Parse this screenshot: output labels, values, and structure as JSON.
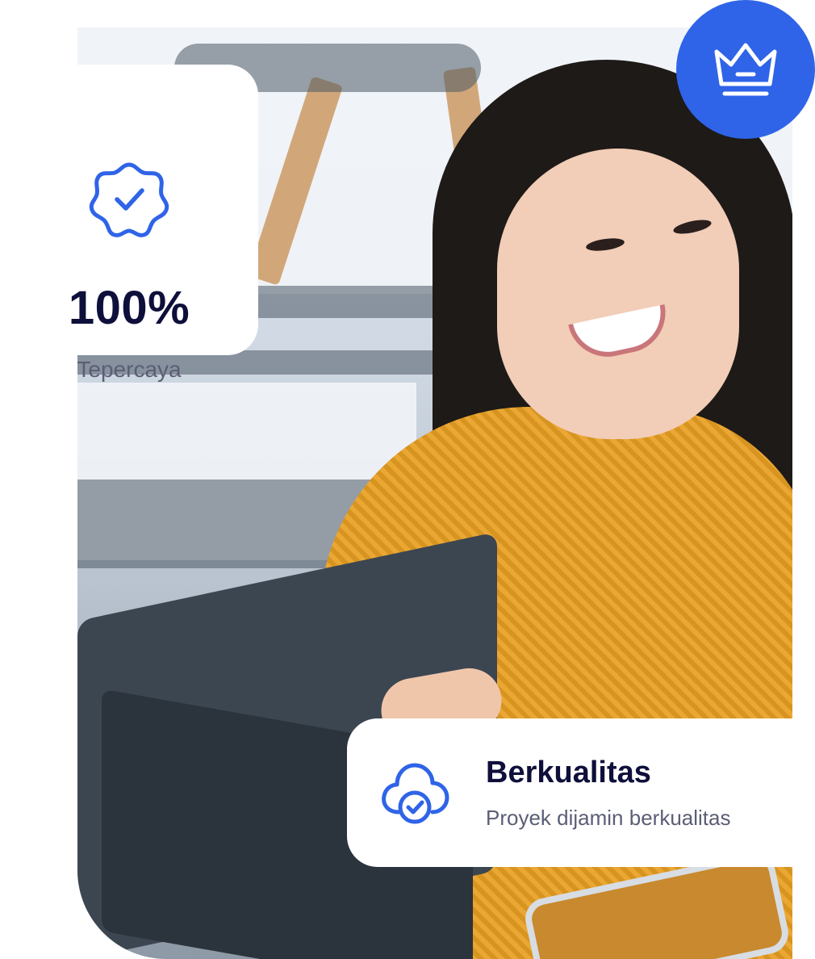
{
  "trust_card": {
    "value": "100%",
    "label": "Tepercaya",
    "icon": "verified-badge-icon"
  },
  "quality_card": {
    "title": "Berkualitas",
    "subtitle": "Proyek dijamin berkualitas",
    "icon": "cloud-check-icon"
  },
  "badge": {
    "icon": "crown-icon"
  },
  "colors": {
    "accent": "#2f64e8",
    "heading": "#0e0f3a",
    "muted": "#5b5e75",
    "card_bg": "#ffffff"
  }
}
